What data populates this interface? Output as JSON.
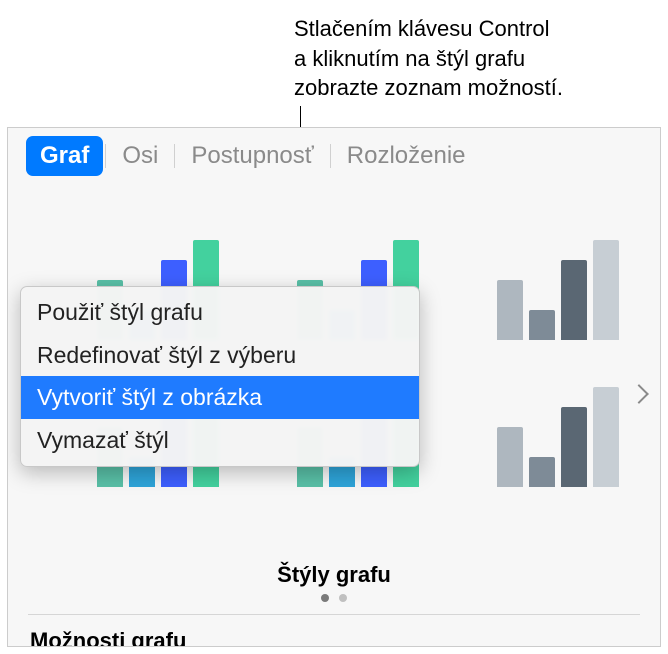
{
  "callout": {
    "line1": "Stlačením klávesu Control",
    "line2": "a kliknutím na štýl grafu",
    "line3": "zobrazte zoznam možností."
  },
  "tabs": {
    "chart": "Graf",
    "axes": "Osi",
    "series": "Postupnosť",
    "layout": "Rozloženie"
  },
  "context_menu": {
    "items": [
      "Použiť štýl grafu",
      "Redefinovať štýl z výberu",
      "Vytvoriť štýl z obrázka",
      "Vymazať štýl"
    ],
    "highlighted_index": 2
  },
  "styles_label": "Štýly grafu",
  "section_title": "Možnosti grafu"
}
